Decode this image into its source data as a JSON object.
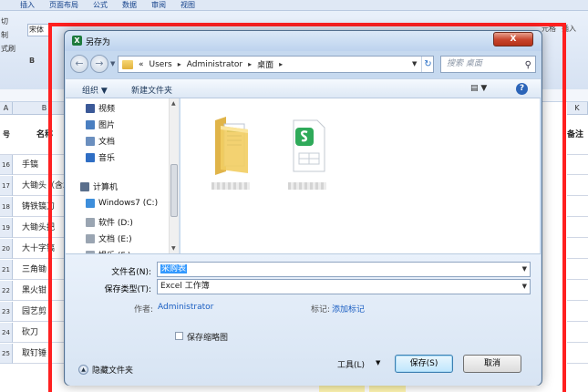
{
  "excel": {
    "menu": [
      "插入",
      "页面布局",
      "公式",
      "数据",
      "审阅",
      "视图"
    ],
    "ribbon_left": [
      "切",
      "制",
      "式刷"
    ],
    "font_name": "宋体",
    "bold_label": "B",
    "ribbon_right": [
      "元格",
      "插入"
    ],
    "right_col_header": "K",
    "col_A": "A",
    "col_B": "B",
    "header_row": {
      "col_a": "号",
      "col_b": "名称",
      "col_k": "备注"
    },
    "rows": [
      {
        "num": "16",
        "name": "手镐"
      },
      {
        "num": "17",
        "name": "大锄头（含木柄）"
      },
      {
        "num": "18",
        "name": "铸铁镐刀"
      },
      {
        "num": "19",
        "name": "大锄头把"
      },
      {
        "num": "20",
        "name": "大十字镐"
      },
      {
        "num": "21",
        "name": "三角锄"
      },
      {
        "num": "22",
        "name": "黑火钳"
      },
      {
        "num": "23",
        "name": "园艺剪"
      },
      {
        "num": "24",
        "name": "砍刀"
      },
      {
        "num": "25",
        "name": "取钉锤"
      }
    ]
  },
  "dialog": {
    "title": "另存为",
    "close_label": "X",
    "address": [
      "«",
      "Users",
      "Administrator",
      "桌面"
    ],
    "search_placeholder": "搜索 桌面",
    "organize_label": "组织 ▼",
    "new_folder_label": "新建文件夹",
    "nav_items": [
      {
        "label": "视频",
        "icon": "video-icon",
        "color": "#3b5998"
      },
      {
        "label": "图片",
        "icon": "picture-icon",
        "color": "#4a7fc1"
      },
      {
        "label": "文档",
        "icon": "document-icon",
        "color": "#6b8fbf"
      },
      {
        "label": "音乐",
        "icon": "music-icon",
        "color": "#2f6ec4"
      },
      {
        "label": "计算机",
        "icon": "computer-icon",
        "color": "#5a6f8c"
      },
      {
        "label": "Windows7 (C:)",
        "icon": "drive-c-icon",
        "color": "#3d8edb"
      },
      {
        "label": "软件 (D:)",
        "icon": "drive-d-icon",
        "color": "#9aa5b2"
      },
      {
        "label": "文档 (E:)",
        "icon": "drive-e-icon",
        "color": "#9aa5b2"
      },
      {
        "label": "娱乐 (F:)",
        "icon": "drive-f-icon",
        "color": "#9aa5b2"
      }
    ],
    "filename_label": "文件名(N):",
    "filename_value": "采购表",
    "filetype_label": "保存类型(T):",
    "filetype_value": "Excel 工作簿",
    "author_label": "作者:",
    "author_value": "Administrator",
    "tags_label": "标记:",
    "tags_value": "添加标记",
    "thumbnail_label": "保存缩略图",
    "hide_folders_label": "隐藏文件夹",
    "tools_label": "工具(L)",
    "save_label": "保存(S)",
    "cancel_label": "取消"
  },
  "colors": {
    "highlight": "#ff2020",
    "accent": "#3399ff",
    "link": "#1a5ec2"
  }
}
